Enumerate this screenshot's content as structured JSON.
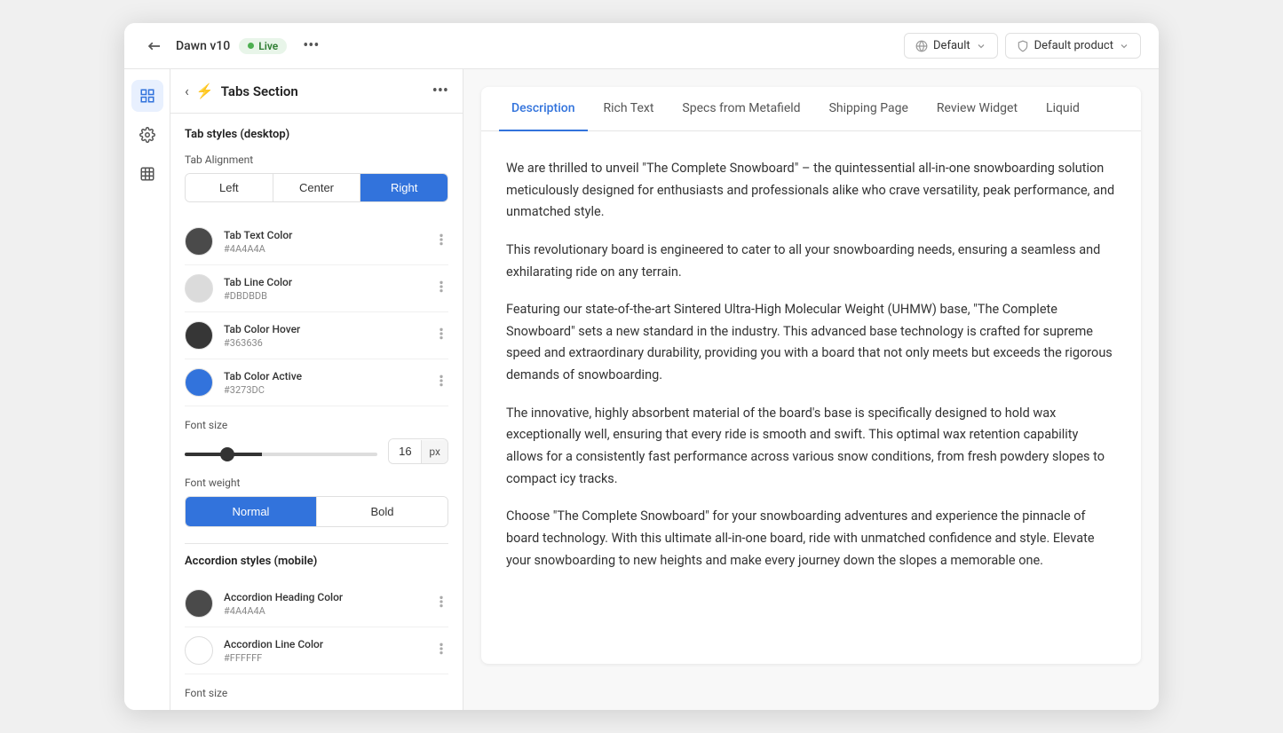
{
  "topBar": {
    "backIcon": "←",
    "themeName": "Dawn v10",
    "liveBadge": "Live",
    "moreIcon": "•••",
    "dropdowns": [
      {
        "icon": "🌐",
        "label": "Default",
        "id": "default-dropdown"
      },
      {
        "icon": "◇",
        "label": "Default product",
        "id": "product-dropdown"
      }
    ]
  },
  "iconSidebar": {
    "items": [
      {
        "icon": "☰",
        "id": "layers-icon",
        "active": true
      },
      {
        "icon": "⚙",
        "id": "settings-icon",
        "active": false
      },
      {
        "icon": "⊞",
        "id": "grid-icon",
        "active": false
      }
    ]
  },
  "panel": {
    "backIcon": "‹",
    "titleIcon": "⚡",
    "title": "Tabs Section",
    "moreIcon": "•••",
    "sectionTitle": "Tab styles (desktop)",
    "tabAlignment": {
      "label": "Tab Alignment",
      "options": [
        "Left",
        "Center",
        "Right"
      ],
      "active": "Right"
    },
    "colors": [
      {
        "label": "Tab Text Color",
        "hex": "#4A4A4A",
        "swatch": "#4A4A4A"
      },
      {
        "label": "Tab Line Color",
        "hex": "#DBDBDB",
        "swatch": "#DBDBDB"
      },
      {
        "label": "Tab Color Hover",
        "hex": "#363636",
        "swatch": "#363636"
      },
      {
        "label": "Tab Color Active",
        "hex": "#3273DC",
        "swatch": "#3273DC"
      }
    ],
    "fontSize": {
      "label": "Font size",
      "value": "16",
      "unit": "px",
      "sliderPercent": 40
    },
    "fontWeight": {
      "label": "Font weight",
      "options": [
        "Normal",
        "Bold"
      ],
      "active": "Normal"
    },
    "accordionTitle": "Accordion styles (mobile)",
    "accordionColors": [
      {
        "label": "Accordion Heading Color",
        "hex": "#4A4A4A",
        "swatch": "#4A4A4A"
      },
      {
        "label": "Accordion Line Color",
        "hex": "#FFFFFF",
        "swatch": "#FFFFFF"
      }
    ],
    "accordionFontSizeLabel": "Font size"
  },
  "preview": {
    "tabs": [
      {
        "label": "Description",
        "active": true
      },
      {
        "label": "Rich Text",
        "active": false
      },
      {
        "label": "Specs from Metafield",
        "active": false
      },
      {
        "label": "Shipping Page",
        "active": false
      },
      {
        "label": "Review Widget",
        "active": false
      },
      {
        "label": "Liquid",
        "active": false
      }
    ],
    "content": {
      "paragraphs": [
        "We are thrilled to unveil \"The Complete Snowboard\" – the quintessential all-in-one snowboarding solution meticulously designed for enthusiasts and professionals alike who crave versatility, peak performance, and unmatched style.",
        "This revolutionary board is engineered to cater to all your snowboarding needs, ensuring a seamless and exhilarating ride on any terrain.",
        "Featuring our state-of-the-art Sintered Ultra-High Molecular Weight (UHMW) base, \"The Complete Snowboard\" sets a new standard in the industry. This advanced base technology is crafted for supreme speed and extraordinary durability, providing you with a board that not only meets but exceeds the rigorous demands of snowboarding.",
        "The innovative, highly absorbent material of the board's base is specifically designed to hold wax exceptionally well, ensuring that every ride is smooth and swift. This optimal wax retention capability allows for a consistently fast performance across various snow conditions, from fresh powdery slopes to compact icy tracks.",
        "Choose \"The Complete Snowboard\" for your snowboarding adventures and experience the pinnacle of board technology. With this ultimate all-in-one board, ride with unmatched confidence and style. Elevate your snowboarding to new heights and make every journey down the slopes a memorable one."
      ]
    }
  }
}
